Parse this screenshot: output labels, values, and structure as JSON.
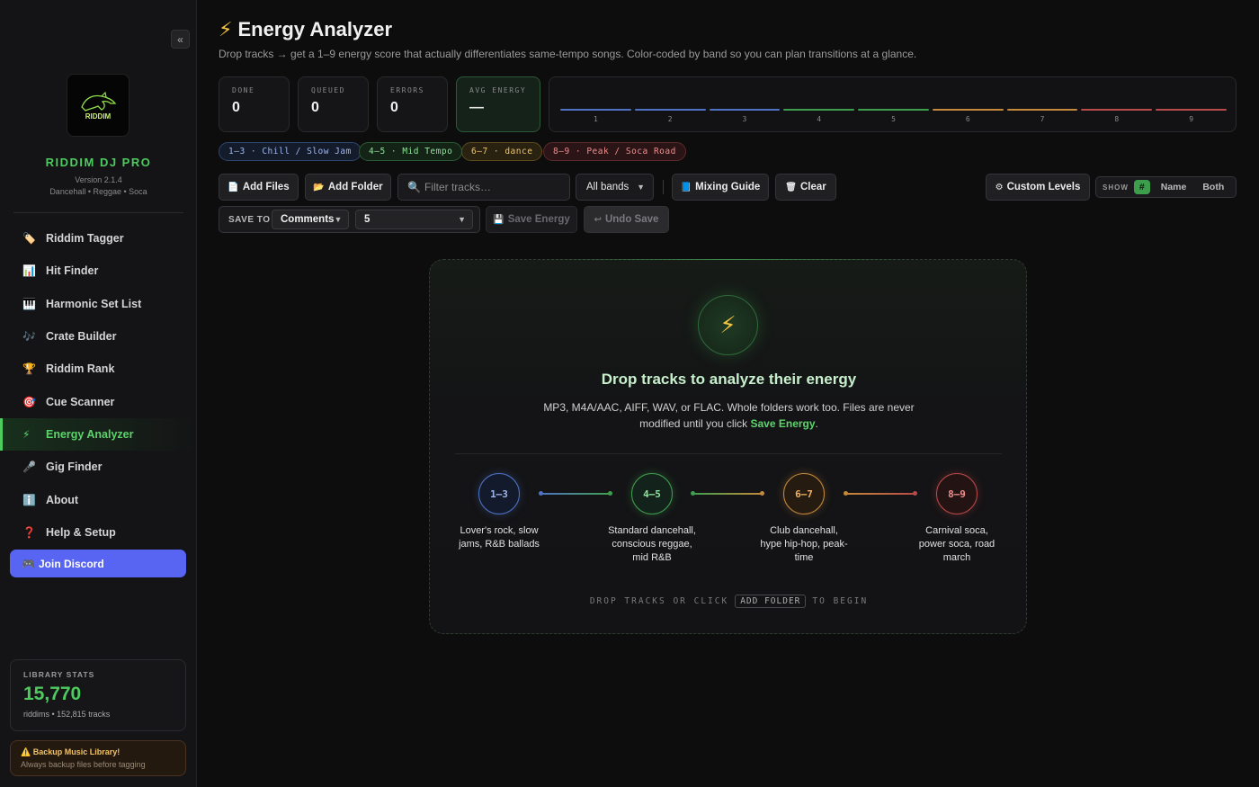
{
  "sidebar": {
    "collapse_glyph": "«",
    "logo_text": "RIDDIM",
    "brand": "RIDDIM DJ PRO",
    "version": "Version 2.1.4",
    "genres": "Dancehall • Reggae • Soca",
    "items": [
      {
        "icon": "🏷️",
        "label": "Riddim Tagger"
      },
      {
        "icon": "📊",
        "label": "Hit Finder"
      },
      {
        "icon": "🎹",
        "label": "Harmonic Set List"
      },
      {
        "icon": "🎶",
        "label": "Crate Builder"
      },
      {
        "icon": "🏆",
        "label": "Riddim Rank"
      },
      {
        "icon": "🎯",
        "label": "Cue Scanner"
      },
      {
        "icon": "⚡",
        "label": "Energy Analyzer"
      },
      {
        "icon": "🎤",
        "label": "Gig Finder"
      },
      {
        "icon": "ℹ️",
        "label": "About"
      },
      {
        "icon": "❓",
        "label": "Help & Setup"
      }
    ],
    "active_index": 6,
    "discord": {
      "icon": "🎮",
      "label": "Join Discord"
    },
    "stats": {
      "label": "LIBRARY STATS",
      "count": "15,770",
      "sub": "riddims • 152,815 tracks"
    },
    "backup": {
      "title": "⚠️ Backup Music Library!",
      "sub": "Always backup files before tagging"
    }
  },
  "header": {
    "title": "Energy Analyzer",
    "bolt": "⚡",
    "subtitle": "Drop tracks → get a 1–9 energy score that actually differentiates same-tempo songs. Color-coded by band so you can plan transitions at a glance."
  },
  "stats": {
    "done": {
      "label": "DONE",
      "value": "0"
    },
    "queued": {
      "label": "QUEUED",
      "value": "0"
    },
    "errors": {
      "label": "ERRORS",
      "value": "0"
    },
    "avg": {
      "label": "AVG ENERGY",
      "value": "—"
    }
  },
  "histogram": {
    "labels": [
      "1",
      "2",
      "3",
      "4",
      "5",
      "6",
      "7",
      "8",
      "9"
    ],
    "colors": [
      "#4f72c4",
      "#4f72c4",
      "#4f72c4",
      "#3f9e4e",
      "#3f9e4e",
      "#c4893a",
      "#c4893a",
      "#b84a4a",
      "#b84a4a"
    ]
  },
  "bands": {
    "b1": "1–3 · Chill / Slow Jam",
    "b2": "4–5 · Mid Tempo",
    "b3": "6–7 · dance",
    "b4": "8–9 · Peak / Soca Road"
  },
  "toolbar": {
    "add_files": "Add Files",
    "add_folder": "Add Folder",
    "filter_placeholder": "Filter tracks…",
    "band_filter": "All bands",
    "mixing_guide": "Mixing Guide",
    "clear": "Clear",
    "custom_levels": "Custom Levels",
    "show_label": "SHOW",
    "show_opts": [
      "#",
      "Name",
      "Both"
    ]
  },
  "save": {
    "label": "SAVE TO",
    "field": "Comments",
    "slot": "5",
    "save_btn": "Save Energy",
    "undo_btn": "Undo Save"
  },
  "dropzone": {
    "icon": "⚡",
    "title": "Drop tracks to analyze their energy",
    "desc_pre": "MP3, M4A/AAC, AIFF, WAV, or FLAC. Whole folders work too. Files are never modified until you click ",
    "desc_hl": "Save Energy",
    "desc_post": ".",
    "bands": [
      {
        "range": "1–3",
        "desc": "Lover's rock, slow jams, R&B ballads"
      },
      {
        "range": "4–5",
        "desc": "Standard dancehall, conscious reggae, mid R&B"
      },
      {
        "range": "6–7",
        "desc": "Club dancehall, hype hip-hop, peak-time"
      },
      {
        "range": "8–9",
        "desc": "Carnival soca, power soca, road march"
      }
    ],
    "foot_pre": "DROP TRACKS OR CLICK",
    "foot_kbd": "ADD FOLDER",
    "foot_post": "TO BEGIN"
  }
}
